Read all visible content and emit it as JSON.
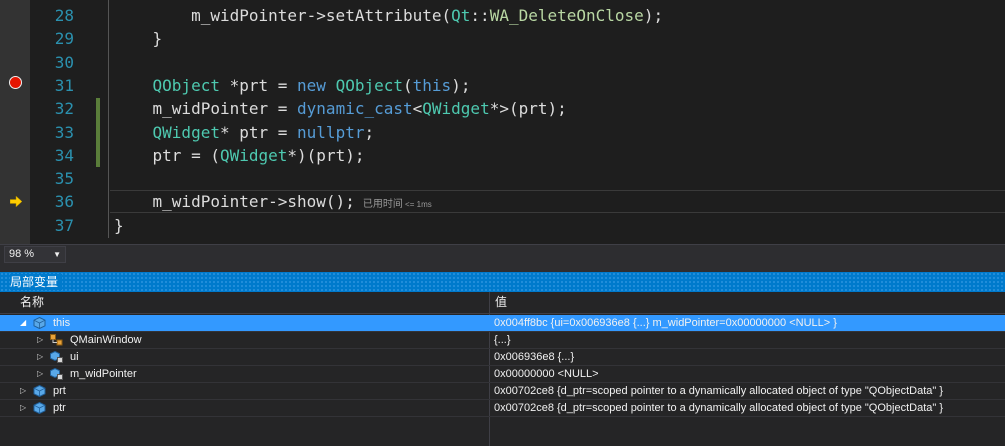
{
  "editor": {
    "lines": [
      {
        "num": "28",
        "code": [
          {
            "t": "        m_widPointer->setAttribute(",
            "c": "plain"
          },
          {
            "t": "Qt",
            "c": "type"
          },
          {
            "t": "::",
            "c": "plain"
          },
          {
            "t": "WA_DeleteOnClose",
            "c": "enum"
          },
          {
            "t": ");",
            "c": "plain"
          }
        ]
      },
      {
        "num": "29",
        "code": [
          {
            "t": "    }",
            "c": "plain"
          }
        ]
      },
      {
        "num": "30",
        "code": []
      },
      {
        "num": "31",
        "code": [
          {
            "t": "    ",
            "c": "plain"
          },
          {
            "t": "QObject",
            "c": "type"
          },
          {
            "t": " *prt = ",
            "c": "plain"
          },
          {
            "t": "new",
            "c": "kw"
          },
          {
            "t": " ",
            "c": "plain"
          },
          {
            "t": "QObject",
            "c": "type"
          },
          {
            "t": "(",
            "c": "plain"
          },
          {
            "t": "this",
            "c": "kw"
          },
          {
            "t": ");",
            "c": "plain"
          }
        ]
      },
      {
        "num": "32",
        "code": [
          {
            "t": "    m_widPointer = ",
            "c": "plain"
          },
          {
            "t": "dynamic_cast",
            "c": "kw"
          },
          {
            "t": "<",
            "c": "plain"
          },
          {
            "t": "QWidget",
            "c": "type"
          },
          {
            "t": "*>(prt);",
            "c": "plain"
          }
        ]
      },
      {
        "num": "33",
        "code": [
          {
            "t": "    ",
            "c": "plain"
          },
          {
            "t": "QWidget",
            "c": "type"
          },
          {
            "t": "* ptr = ",
            "c": "plain"
          },
          {
            "t": "nullptr",
            "c": "kw"
          },
          {
            "t": ";",
            "c": "plain"
          }
        ]
      },
      {
        "num": "34",
        "code": [
          {
            "t": "    ptr = (",
            "c": "plain"
          },
          {
            "t": "QWidget",
            "c": "type"
          },
          {
            "t": "*)(prt);",
            "c": "plain"
          }
        ]
      },
      {
        "num": "35",
        "code": []
      },
      {
        "num": "36",
        "code": [
          {
            "t": "    m_widPointer->show();",
            "c": "plain"
          }
        ],
        "current": true,
        "elapsed": "已用时间",
        "elapsed_small": "<= 1ms"
      },
      {
        "num": "37",
        "code": [
          {
            "t": "}",
            "c": "plain"
          }
        ]
      }
    ],
    "breakpoint_line": "31",
    "current_line": "36"
  },
  "zoom": {
    "value": "98 %"
  },
  "locals": {
    "title": "局部变量",
    "col_name": "名称",
    "col_value": "值",
    "rows": [
      {
        "name": "this",
        "value": "0x004ff8bc {ui=0x006936e8 {...} m_widPointer=0x00000000 <NULL> }",
        "indent": 0,
        "expanded": true,
        "selected": true,
        "icon": "variable-icon"
      },
      {
        "name": "QMainWindow",
        "value": "{...}",
        "indent": 1,
        "expanded": false,
        "selected": false,
        "icon": "base-class-icon"
      },
      {
        "name": "ui",
        "value": "0x006936e8 {...}",
        "indent": 1,
        "expanded": false,
        "selected": false,
        "icon": "private-member-icon"
      },
      {
        "name": "m_widPointer",
        "value": "0x00000000 <NULL>",
        "indent": 1,
        "expanded": false,
        "selected": false,
        "icon": "private-member-icon"
      },
      {
        "name": "prt",
        "value": "0x00702ce8 {d_ptr=scoped pointer to a dynamically allocated object of type \"QObjectData\" }",
        "indent": 0,
        "expanded": false,
        "selected": false,
        "icon": "variable-icon"
      },
      {
        "name": "ptr",
        "value": "0x00702ce8 {d_ptr=scoped pointer to a dynamically allocated object of type \"QObjectData\" }",
        "indent": 0,
        "expanded": false,
        "selected": false,
        "icon": "variable-icon"
      }
    ]
  },
  "colors": {
    "accent": "#007acc",
    "selection": "#3399ff",
    "breakpoint": "#e51400",
    "line_number": "#2b91af"
  }
}
